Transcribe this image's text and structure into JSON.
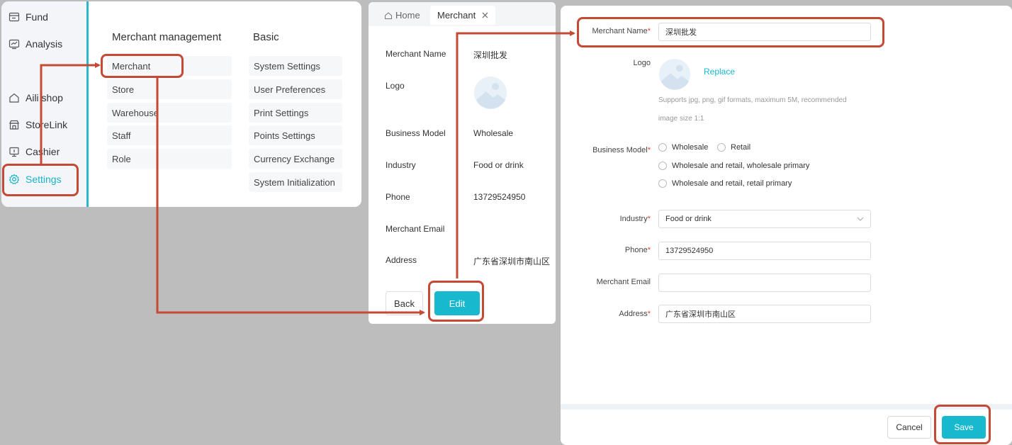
{
  "sidebar": {
    "items": [
      {
        "label": "Fund",
        "icon": "wallet-icon"
      },
      {
        "label": "Analysis",
        "icon": "chart-icon"
      },
      {
        "label": "Aili shop",
        "icon": "home-icon"
      },
      {
        "label": "StoreLink",
        "icon": "store-icon"
      },
      {
        "label": "Cashier",
        "icon": "cashier-icon"
      },
      {
        "label": "Settings",
        "icon": "gear-icon",
        "active": true
      }
    ]
  },
  "menu": {
    "merchant_heading": "Merchant management",
    "basic_heading": "Basic",
    "merchant_items": [
      "Merchant",
      "Store",
      "Warehouse",
      "Staff",
      "Role"
    ],
    "basic_items": [
      "System Settings",
      "User Preferences",
      "Print Settings",
      "Points Settings",
      "Currency Exchange",
      "System Initialization"
    ]
  },
  "detail": {
    "tabs": {
      "home": "Home",
      "merchant": "Merchant"
    },
    "fields": [
      {
        "label": "Merchant Name",
        "value": "深圳批发"
      },
      {
        "label": "Logo",
        "value": ""
      },
      {
        "label": "Business Model",
        "value": "Wholesale"
      },
      {
        "label": "Industry",
        "value": "Food or drink"
      },
      {
        "label": "Phone",
        "value": "13729524950"
      },
      {
        "label": "Merchant Email",
        "value": ""
      },
      {
        "label": "Address",
        "value": "广东省深圳市南山区"
      }
    ],
    "back_label": "Back",
    "edit_label": "Edit"
  },
  "form": {
    "merchant_name_label": "Merchant Name",
    "merchant_name_value": "深圳批发",
    "logo_label": "Logo",
    "replace_label": "Replace",
    "logo_hint_line1": "Supports jpg, png, gif formats, maximum 5M, recommended",
    "logo_hint_line2": "image size 1:1",
    "business_model_label": "Business Model",
    "business_options": [
      "Wholesale",
      "Retail",
      "Wholesale and retail, wholesale primary",
      "Wholesale and retail, retail primary"
    ],
    "industry_label": "Industry",
    "industry_value": "Food or drink",
    "phone_label": "Phone",
    "phone_value": "13729524950",
    "email_label": "Merchant Email",
    "email_value": "",
    "address_label": "Address",
    "address_value": "广东省深圳市南山区",
    "required_mark": "*",
    "cancel_label": "Cancel",
    "save_label": "Save"
  },
  "colors": {
    "accent": "#18b8cf",
    "annotation": "#c44a35",
    "background": "#bdbdbd"
  }
}
